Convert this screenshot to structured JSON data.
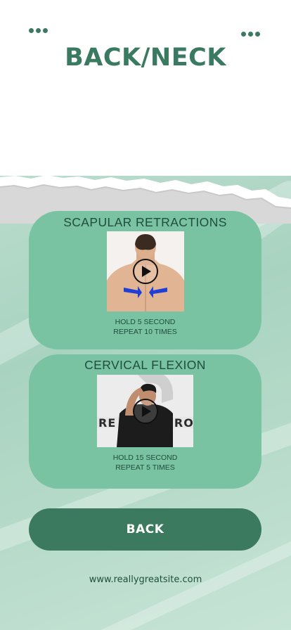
{
  "header": {
    "title": "BACK/NECK",
    "left_menu_icon": "more-dots-icon",
    "right_menu_icon": "more-dots-icon"
  },
  "exercises": [
    {
      "title": "SCAPULAR RETRACTIONS",
      "instruction_line1": "HOLD 5 SECOND",
      "instruction_line2": "REPEAT 10 TIMES",
      "icon": "play-icon"
    },
    {
      "title": "CERVICAL FLEXION",
      "instruction_line1": "HOLD 15 SECOND",
      "instruction_line2": "REPEAT 5 TIMES",
      "icon": "play-icon"
    }
  ],
  "footer": {
    "back_label": "BACK",
    "website": "www.reallygreatsite.com"
  },
  "colors": {
    "accent": "#3a7a60",
    "card": "#79c2a2",
    "background_lower": "#b9dccd"
  }
}
